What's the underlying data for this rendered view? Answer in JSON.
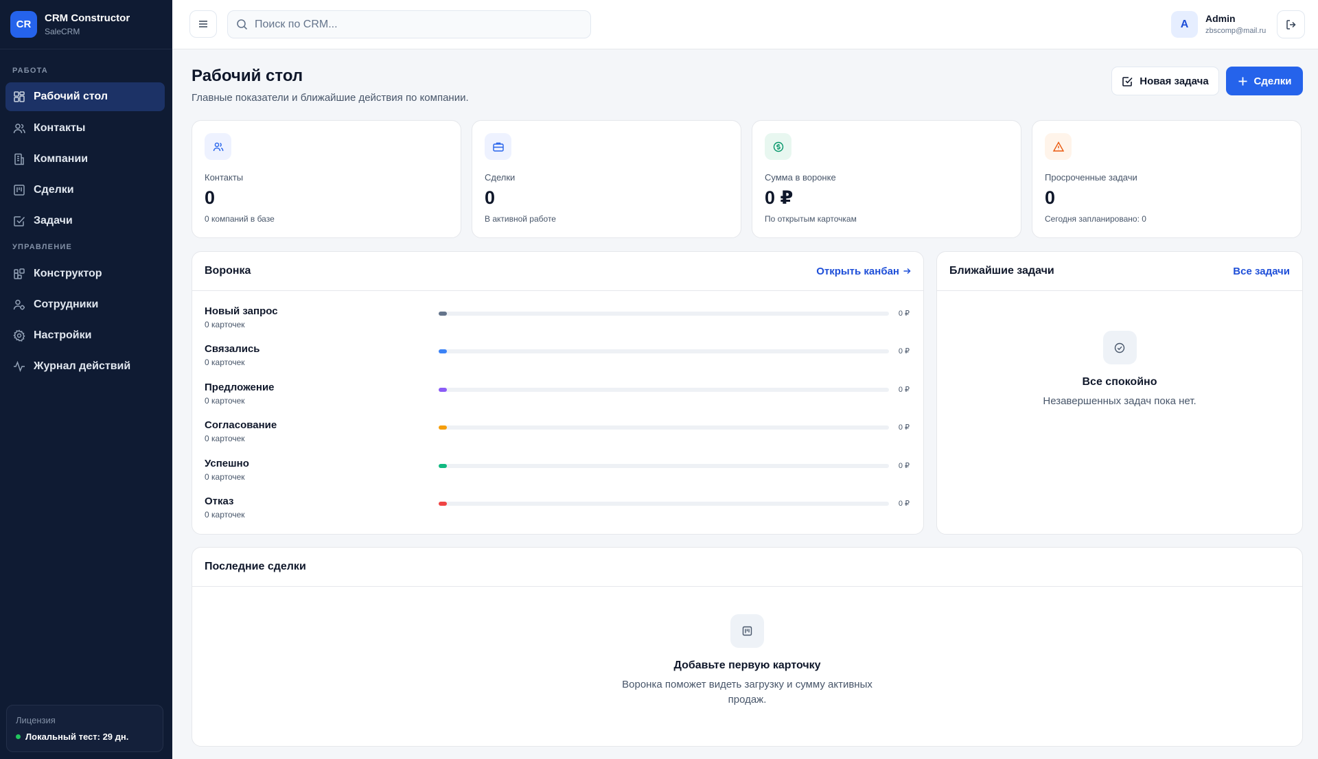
{
  "brand": {
    "logo": "CR",
    "title": "CRM Constructor",
    "subtitle": "SaleCRM"
  },
  "sidebar": {
    "section_work": "РАБОТА",
    "section_manage": "УПРАВЛЕНИЕ",
    "items": [
      {
        "label": "Рабочий стол",
        "icon": "dashboard-icon",
        "active": true
      },
      {
        "label": "Контакты",
        "icon": "contacts-icon"
      },
      {
        "label": "Компании",
        "icon": "companies-icon"
      },
      {
        "label": "Сделки",
        "icon": "deals-icon"
      },
      {
        "label": "Задачи",
        "icon": "tasks-icon"
      },
      {
        "label": "Конструктор",
        "icon": "constructor-icon"
      },
      {
        "label": "Сотрудники",
        "icon": "employees-icon"
      },
      {
        "label": "Настройки",
        "icon": "settings-icon"
      },
      {
        "label": "Журнал действий",
        "icon": "activity-icon"
      }
    ],
    "license": {
      "label": "Лицензия",
      "status": "Локальный тест: 29 дн."
    }
  },
  "topbar": {
    "search_placeholder": "Поиск по CRM...",
    "user": {
      "initial": "A",
      "name": "Admin",
      "email": "zbscomp@mail.ru"
    }
  },
  "page": {
    "title": "Рабочий стол",
    "subtitle": "Главные показатели и ближайшие действия по компании.",
    "new_task_label": "Новая задача",
    "deals_label": "Сделки"
  },
  "stats": [
    {
      "label": "Контакты",
      "value": "0",
      "hint": "0 компаний в базе",
      "icon": "users-icon",
      "color": "#2563eb",
      "bg": "#eef2ff"
    },
    {
      "label": "Сделки",
      "value": "0",
      "hint": "В активной работе",
      "icon": "briefcase-icon",
      "color": "#2563eb",
      "bg": "#eef2ff"
    },
    {
      "label": "Сумма в воронке",
      "value": "0 ₽",
      "hint": "По открытым карточкам",
      "icon": "dollar-icon",
      "color": "#059669",
      "bg": "#e8f7f0"
    },
    {
      "label": "Просроченные задачи",
      "value": "0",
      "hint": "Сегодня запланировано: 0",
      "icon": "warning-icon",
      "color": "#ea580c",
      "bg": "#fff4ea"
    }
  ],
  "funnel": {
    "title": "Воронка",
    "link": "Открыть канбан",
    "stages": [
      {
        "name": "Новый запрос",
        "count": "0 карточек",
        "sum": "0 ₽",
        "color": "#64748b",
        "progress": 0
      },
      {
        "name": "Связались",
        "count": "0 карточек",
        "sum": "0 ₽",
        "color": "#3b82f6",
        "progress": 0
      },
      {
        "name": "Предложение",
        "count": "0 карточек",
        "sum": "0 ₽",
        "color": "#8b5cf6",
        "progress": 0
      },
      {
        "name": "Согласование",
        "count": "0 карточек",
        "sum": "0 ₽",
        "color": "#f59e0b",
        "progress": 0
      },
      {
        "name": "Успешно",
        "count": "0 карточек",
        "sum": "0 ₽",
        "color": "#10b981",
        "progress": 0
      },
      {
        "name": "Отказ",
        "count": "0 карточек",
        "sum": "0 ₽",
        "color": "#ef4444",
        "progress": 0
      }
    ]
  },
  "tasks": {
    "title": "Ближайшие задачи",
    "link": "Все задачи",
    "empty_title": "Все спокойно",
    "empty_text": "Незавершенных задач пока нет."
  },
  "recent_deals": {
    "title": "Последние сделки",
    "empty_title": "Добавьте первую карточку",
    "empty_text_1": "Воронка поможет видеть загрузку и сумму активных",
    "empty_text_2": "продаж."
  }
}
